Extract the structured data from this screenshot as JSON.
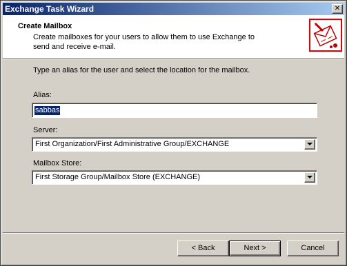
{
  "window": {
    "title": "Exchange Task Wizard",
    "close_glyph": "✕"
  },
  "header": {
    "title": "Create Mailbox",
    "description": "Create mailboxes for your users to allow them to use Exchange to send and receive e-mail.",
    "icon": "mailbox-wizard-icon"
  },
  "body": {
    "instruction": "Type an alias for the user and select the location for the mailbox.",
    "alias": {
      "label": "Alias:",
      "value": "sabbas"
    },
    "server": {
      "label": "Server:",
      "selected": "First Organization/First Administrative Group/EXCHANGE"
    },
    "mailbox_store": {
      "label": "Mailbox Store:",
      "selected": "First Storage Group/Mailbox Store (EXCHANGE)"
    }
  },
  "buttons": {
    "back": "< Back",
    "next": "Next >",
    "cancel": "Cancel"
  },
  "colors": {
    "title_gradient_start": "#0a246a",
    "title_gradient_end": "#a6caf0",
    "dialog_bg": "#d4d0c8",
    "icon_red": "#e00000"
  }
}
